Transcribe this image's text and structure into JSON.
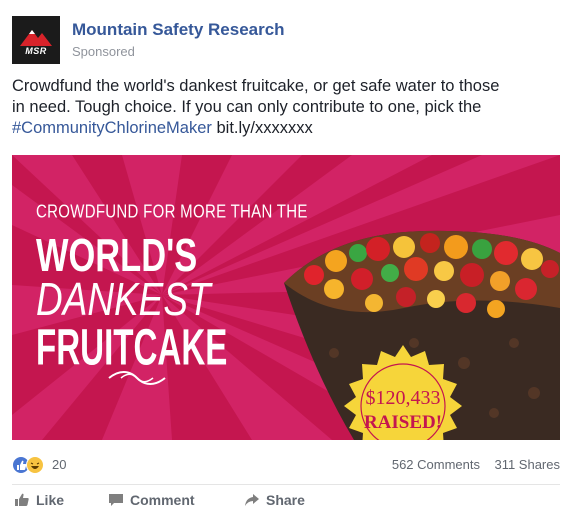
{
  "post": {
    "page_name": "Mountain Safety Research",
    "sponsored_label": "Sponsored",
    "logo_text": "MSR",
    "text_lines": [
      "Crowdfund the world's dankest fruitcake, or get safe water to those",
      "in need. Tough choice. If you can only contribute to one, pick the"
    ],
    "hashtag": "#CommunityChlorineMaker",
    "link": "bit.ly/xxxxxxx"
  },
  "ad": {
    "pre_headline": "CROWDFUND FOR MORE THAN THE",
    "headline_line1": "WORLD'S",
    "headline_line2": "DANKEST",
    "headline_line3": "FRUITCAKE",
    "amount": "$120,433",
    "amount_label": "RAISED!",
    "background_color": "#c4164f",
    "seal_color": "#f6d53a"
  },
  "stats": {
    "reaction_count": "20",
    "comments": "562 Comments",
    "shares": "311 Shares",
    "reaction_icons": [
      "like-icon",
      "haha-icon"
    ]
  },
  "actions": {
    "like_label": "Like",
    "comment_label": "Comment",
    "share_label": "Share"
  }
}
